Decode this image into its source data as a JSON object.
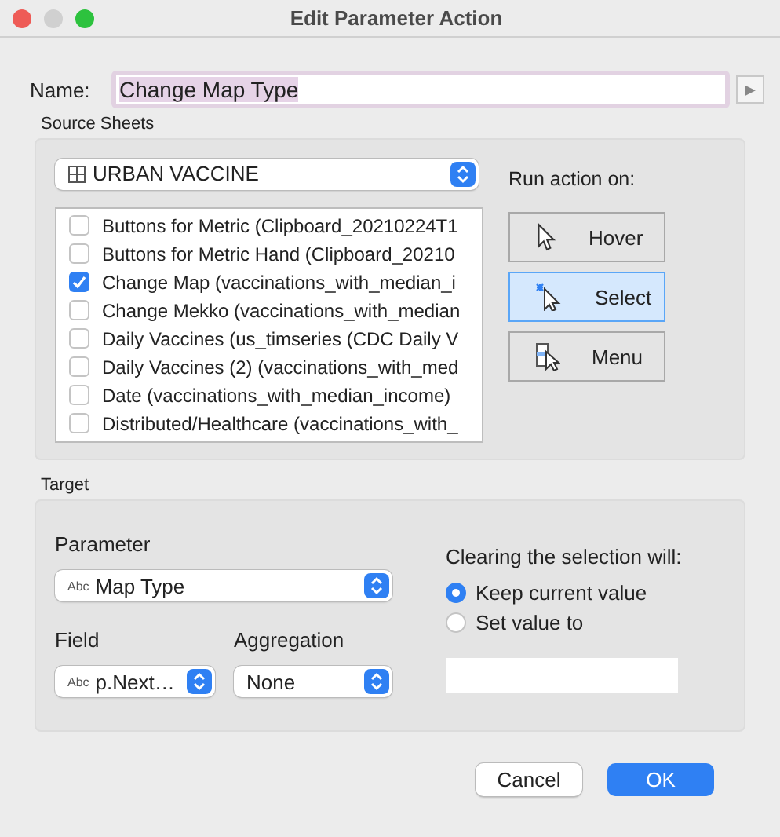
{
  "window": {
    "title": "Edit Parameter Action"
  },
  "name_field": {
    "label": "Name:",
    "value": "Change Map Type",
    "arrow": "▶"
  },
  "source_sheets": {
    "label": "Source Sheets",
    "data_source": "URBAN VACCINE",
    "sheets": [
      {
        "label": "Buttons for Metric (Clipboard_20210224T1",
        "checked": false
      },
      {
        "label": "Buttons for Metric Hand (Clipboard_20210",
        "checked": false
      },
      {
        "label": "Change Map (vaccinations_with_median_i",
        "checked": true
      },
      {
        "label": "Change Mekko (vaccinations_with_median",
        "checked": false
      },
      {
        "label": "Daily Vaccines (us_timseries (CDC Daily V",
        "checked": false
      },
      {
        "label": "Daily Vaccines (2) (vaccinations_with_med",
        "checked": false
      },
      {
        "label": "Date (vaccinations_with_median_income)",
        "checked": false
      },
      {
        "label": "Distributed/Healthcare (vaccinations_with_",
        "checked": false
      }
    ],
    "run_action_label": "Run action on:",
    "run_options": [
      {
        "kind": "hover",
        "label": "Hover",
        "selected": false
      },
      {
        "kind": "select",
        "label": "Select",
        "selected": true
      },
      {
        "kind": "menu",
        "label": "Menu",
        "selected": false
      }
    ]
  },
  "target": {
    "label": "Target",
    "parameter_label": "Parameter",
    "parameter_type": "Abc",
    "parameter": "Map Type",
    "field_label": "Field",
    "field_type": "Abc",
    "field": "p.Next…",
    "aggregation_label": "Aggregation",
    "aggregation": "None",
    "clearing_label": "Clearing the selection will:",
    "clearing_options": [
      {
        "label": "Keep current value",
        "selected": true
      },
      {
        "label": "Set value to",
        "selected": false
      }
    ]
  },
  "buttons": [
    {
      "label": "Cancel",
      "kind": "secondary"
    },
    {
      "label": "OK",
      "kind": "primary"
    }
  ]
}
